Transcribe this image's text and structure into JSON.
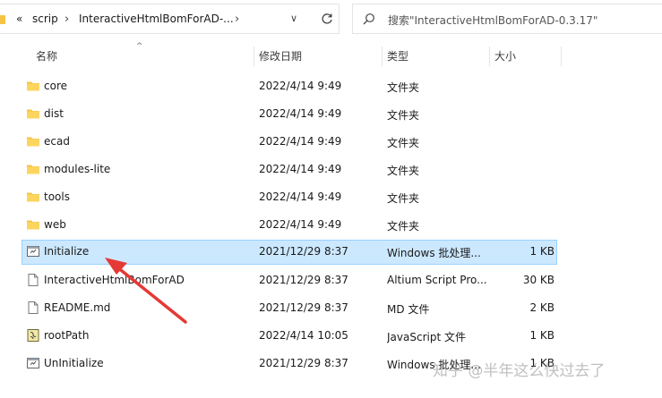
{
  "address_bar": {
    "back_glyph": "«",
    "crumbs": [
      "scrip",
      "InteractiveHtmlBomForAD-..."
    ],
    "dropdown_icon": "chevron-down-icon",
    "refresh_icon": "refresh-icon"
  },
  "search": {
    "placeholder": "搜索\"InteractiveHtmlBomForAD-0.3.17\""
  },
  "columns": {
    "name": "名称",
    "date": "修改日期",
    "type": "类型",
    "size": "大小"
  },
  "files": [
    {
      "name": "core",
      "date": "2022/4/14 9:49",
      "type": "文件夹",
      "size": "",
      "icon": "folder-icon"
    },
    {
      "name": "dist",
      "date": "2022/4/14 9:49",
      "type": "文件夹",
      "size": "",
      "icon": "folder-icon"
    },
    {
      "name": "ecad",
      "date": "2022/4/14 9:49",
      "type": "文件夹",
      "size": "",
      "icon": "folder-icon"
    },
    {
      "name": "modules-lite",
      "date": "2022/4/14 9:49",
      "type": "文件夹",
      "size": "",
      "icon": "folder-icon"
    },
    {
      "name": "tools",
      "date": "2022/4/14 9:49",
      "type": "文件夹",
      "size": "",
      "icon": "folder-icon"
    },
    {
      "name": "web",
      "date": "2022/4/14 9:49",
      "type": "文件夹",
      "size": "",
      "icon": "folder-icon"
    },
    {
      "name": "Initialize",
      "date": "2021/12/29 8:37",
      "type": "Windows 批处理...",
      "size": "1 KB",
      "icon": "batch-file-icon",
      "selected": true
    },
    {
      "name": "InteractiveHtmlBomForAD",
      "date": "2021/12/29 8:37",
      "type": "Altium Script Pro...",
      "size": "30 KB",
      "icon": "file-icon"
    },
    {
      "name": "README.md",
      "date": "2021/12/29 8:37",
      "type": "MD 文件",
      "size": "2 KB",
      "icon": "file-icon"
    },
    {
      "name": "rootPath",
      "date": "2022/4/14 10:05",
      "type": "JavaScript 文件",
      "size": "1 KB",
      "icon": "script-file-icon"
    },
    {
      "name": "UnInitialize",
      "date": "2021/12/29 8:37",
      "type": "Windows 批处理...",
      "size": "1 KB",
      "icon": "batch-file-icon"
    }
  ],
  "watermark": "知乎 @半年这么快过去了",
  "colors": {
    "folder": "#f6c344",
    "selection_bg": "#cce8ff",
    "selection_border": "#99d1ff",
    "annotation_arrow": "#e53935"
  }
}
